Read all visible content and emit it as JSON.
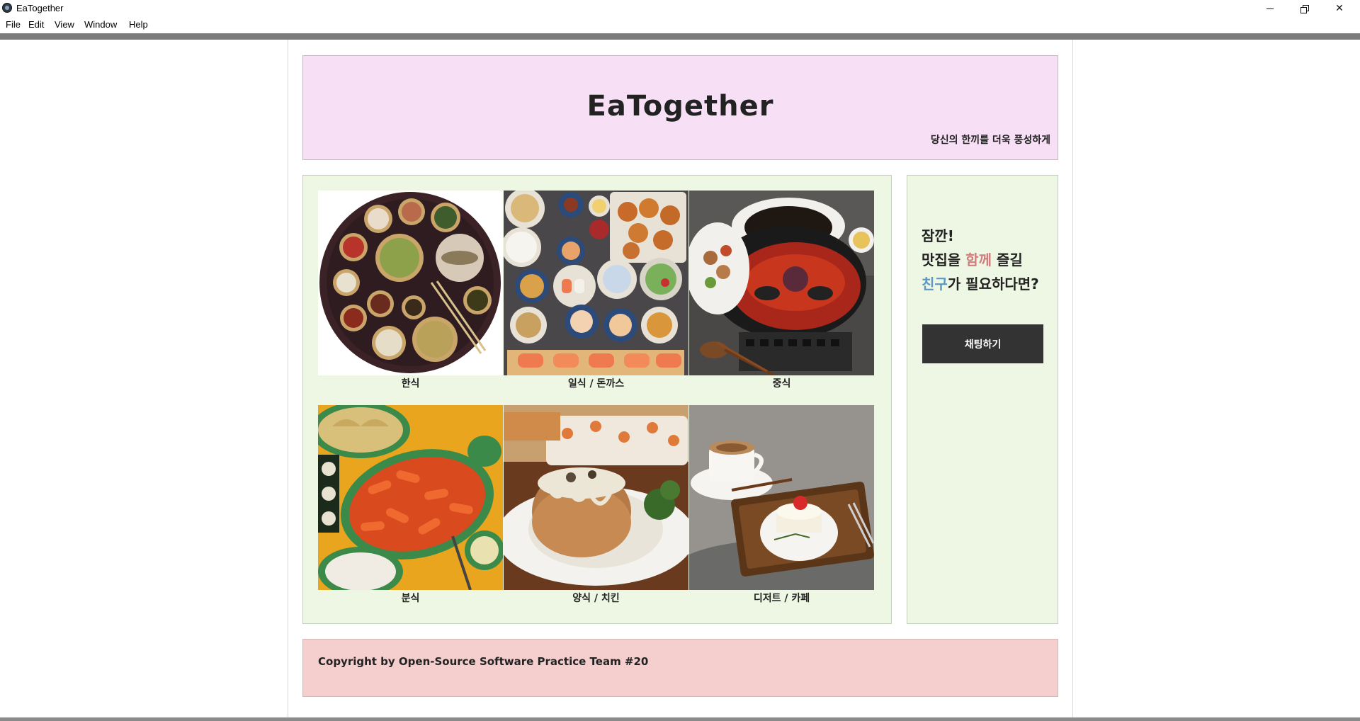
{
  "window": {
    "title": "EaTogether",
    "menu": [
      "File",
      "Edit",
      "View",
      "Window",
      "Help"
    ]
  },
  "header": {
    "title": "EaTogether",
    "subtitle": "당신의 한끼를 더욱 풍성하게"
  },
  "categories": [
    {
      "label": "한식",
      "image": "korean-food-photo"
    },
    {
      "label": "일식 / 돈까스",
      "image": "japanese-food-photo"
    },
    {
      "label": "중식",
      "image": "chinese-food-photo"
    },
    {
      "label": "분식",
      "image": "snack-food-photo"
    },
    {
      "label": "양식 / 치킨",
      "image": "western-food-photo"
    },
    {
      "label": "디저트 / 카페",
      "image": "dessert-cafe-photo"
    }
  ],
  "sidebar": {
    "line1": "잠깐!",
    "line2_a": "맛집을 ",
    "line2_b": "함께",
    "line2_c": " 즐길",
    "line3_a": "친구",
    "line3_b": "가 필요하다면?",
    "button": "채팅하기"
  },
  "footer": {
    "copyright": "Copyright by Open-Source Software Practice Team #20"
  },
  "colors": {
    "header_bg": "#f7dff5",
    "content_bg": "#eef7e3",
    "footer_bg": "#f5cece",
    "accent_pink": "#cf7d7d",
    "accent_blue": "#5d97c4",
    "button_bg": "#333333"
  }
}
